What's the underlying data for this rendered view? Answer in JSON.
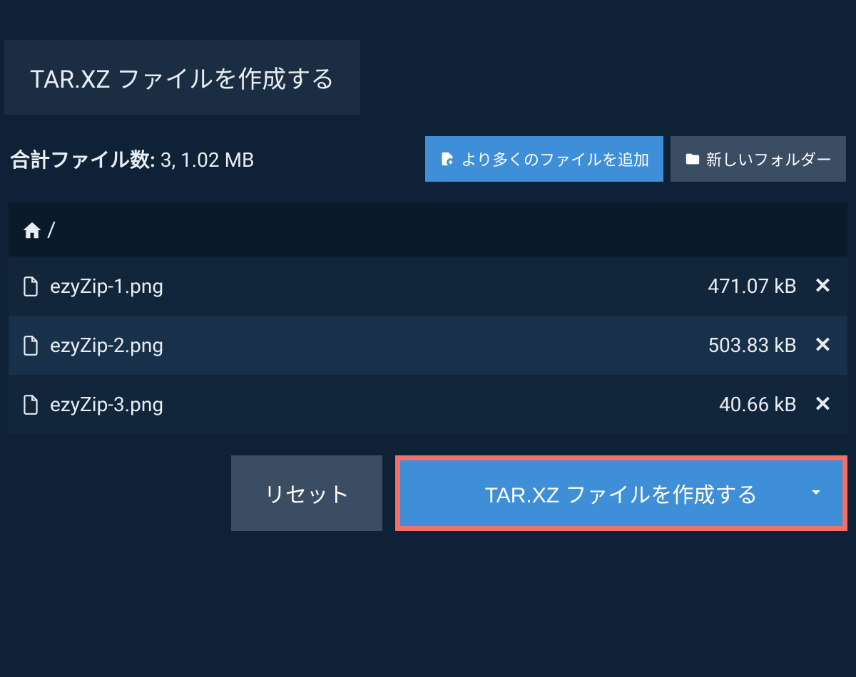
{
  "tab": {
    "title": "TAR.XZ ファイルを作成する"
  },
  "summary": {
    "label": "合計ファイル数:",
    "value": "3, 1.02 MB"
  },
  "toolbar": {
    "add_files_label": "より多くのファイルを追加",
    "new_folder_label": "新しいフォルダー"
  },
  "breadcrumb": {
    "separator": "/"
  },
  "files": [
    {
      "name": "ezyZip-1.png",
      "size": "471.07 kB"
    },
    {
      "name": "ezyZip-2.png",
      "size": "503.83 kB"
    },
    {
      "name": "ezyZip-3.png",
      "size": "40.66 kB"
    }
  ],
  "actions": {
    "reset_label": "リセット",
    "create_label": "TAR.XZ ファイルを作成する"
  }
}
